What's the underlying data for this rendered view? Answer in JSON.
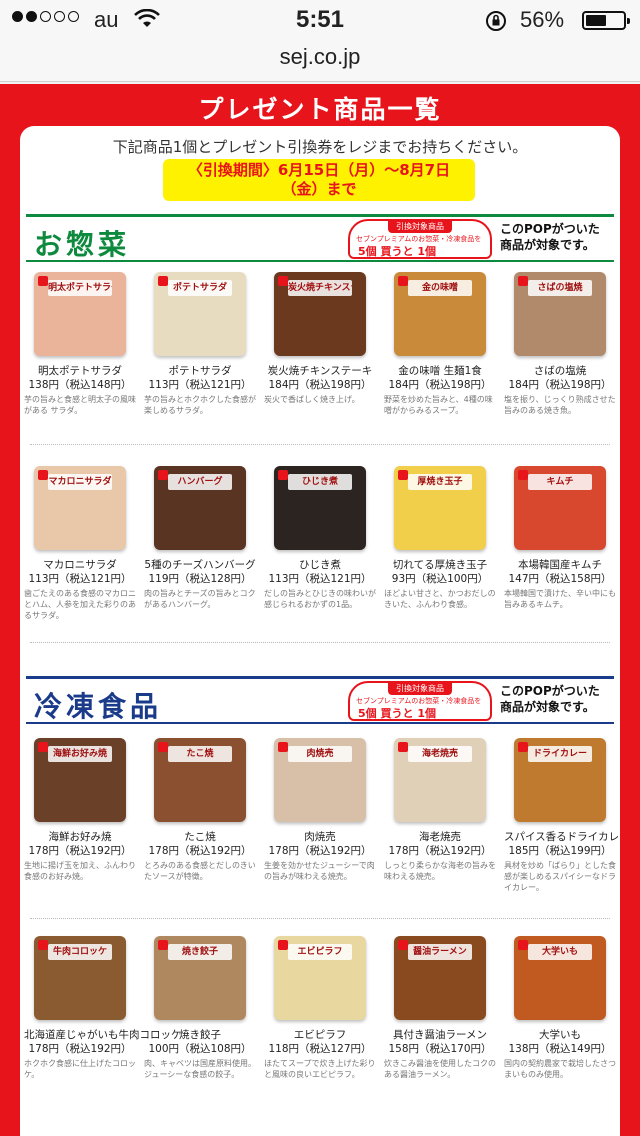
{
  "status_bar": {
    "carrier": "au",
    "time": "5:51",
    "battery_text": "56%",
    "battery_level": 0.56,
    "signal_bars": 2,
    "signal_total": 5
  },
  "url_bar": {
    "domain": "sej.co.jp"
  },
  "page": {
    "heading": "プレゼント商品一覧",
    "intro": "下記商品1個とプレゼント引換券をレジまでお持ちください。",
    "period_line1": "〈引換期間〉6月15日（月）〜8月7日",
    "period_line2": "（金）まで"
  },
  "sections": [
    {
      "title": "お惣菜",
      "color": "#0e8a3e",
      "pop_head": "引換対象商品",
      "pop_line": "セブンプレミアムのお惣菜・冷凍食品を",
      "pop_offer": "5個 買うと 1個",
      "pop_note_line1": "このPOPがついた",
      "pop_note_line2": "商品が対象です。",
      "items": [
        {
          "name": "明太ポテトサラダ",
          "price": "138円（税込148円）",
          "desc": "芋の旨みと食感と明太子の風味がある サラダ。",
          "pkg": "明太ポテトサラダ",
          "bg": "#e9b49a"
        },
        {
          "name": "ポテトサラダ",
          "price": "113円（税込121円）",
          "desc": "芋の旨みとホクホクした食感が楽しめるサラダ。",
          "pkg": "ポテトサラダ",
          "bg": "#e8dcc0"
        },
        {
          "name": "炭火焼チキンステーキ",
          "price": "184円（税込198円）",
          "desc": "炭火で香ばしく焼き上げ。",
          "pkg": "炭火焼チキンステーキ",
          "bg": "#6b3a1e"
        },
        {
          "name": "金の味噌 生麺1食",
          "price": "184円（税込198円）",
          "desc": "野菜を炒めた旨みと、4種の味噌がからみるスープ。",
          "pkg": "金の味噌",
          "bg": "#c98a3a"
        },
        {
          "name": "さばの塩焼",
          "price": "184円（税込198円）",
          "desc": "塩を振り、じっくり熟成させた旨みのある焼き魚。",
          "pkg": "さばの塩焼",
          "bg": "#b08a6a"
        }
      ]
    },
    {
      "items": [
        {
          "name": "マカロニサラダ",
          "price": "113円（税込121円）",
          "desc": "歯ごたえのある食感のマカロニとハム、人参を加えた彩りのあるサラダ。",
          "pkg": "マカロニサラダ",
          "bg": "#e8c8a8"
        },
        {
          "name": "5種のチーズハンバーグ",
          "price": "119円（税込128円）",
          "desc": "肉の旨みとチーズの旨みとコクがあるハンバーグ。",
          "pkg": "ハンバーグ",
          "bg": "#5a3422"
        },
        {
          "name": "ひじき煮",
          "price": "113円（税込121円）",
          "desc": "だしの旨みとひじきの味わいが感じられるおかずの1品。",
          "pkg": "ひじき煮",
          "bg": "#2b2420"
        },
        {
          "name": "切れてる厚焼き玉子",
          "price": "93円（税込100円）",
          "desc": "ほどよい甘さと、かつおだしのきいた、ふんわり食感。",
          "pkg": "厚焼き玉子",
          "bg": "#f1cf4a"
        },
        {
          "name": "本場韓国産キムチ",
          "price": "147円（税込158円）",
          "desc": "本場韓国で漬けた、辛い中にも旨みあるキムチ。",
          "pkg": "キムチ",
          "bg": "#d8482e"
        }
      ]
    },
    {
      "title": "冷凍食品",
      "color": "#1a3a8a",
      "pop_head": "引換対象商品",
      "pop_line": "セブンプレミアムのお惣菜・冷凍食品を",
      "pop_offer": "5個 買うと 1個",
      "pop_note_line1": "このPOPがついた",
      "pop_note_line2": "商品が対象です。",
      "items": [
        {
          "name": "海鮮お好み焼",
          "price": "178円（税込192円）",
          "desc": "生地に揚げ玉を加え、ふんわり食感のお好み焼。",
          "pkg": "海鮮お好み焼",
          "bg": "#6a4028"
        },
        {
          "name": "たこ焼",
          "price": "178円（税込192円）",
          "desc": "とろみのある食感とだしのきいたソースが特徴。",
          "pkg": "たこ焼",
          "bg": "#8a5030"
        },
        {
          "name": "肉焼売",
          "price": "178円（税込192円）",
          "desc": "生姜を効かせたジューシーで肉の旨みが味わえる焼売。",
          "pkg": "肉焼売",
          "bg": "#d8c0a8"
        },
        {
          "name": "海老焼売",
          "price": "178円（税込192円）",
          "desc": "しっとり柔らかな海老の旨みを味わえる焼売。",
          "pkg": "海老焼売",
          "bg": "#e0d0b8"
        },
        {
          "name": "スパイス香るドライカレー",
          "price": "185円（税込199円）",
          "desc": "具材を炒め「ばらり」とした食感が楽しめるスパイシーなドライカレー。",
          "pkg": "ドライカレー",
          "bg": "#c07a30"
        }
      ]
    },
    {
      "items": [
        {
          "name": "北海道産じゃがいも牛肉コロッケ",
          "price": "178円（税込192円）",
          "desc": "ホクホク食感に仕上げたコロッケ。",
          "pkg": "牛肉コロッケ",
          "bg": "#8a5a30"
        },
        {
          "name": "焼き餃子",
          "price": "100円（税込108円）",
          "desc": "肉、キャベツは国産原料使用。ジューシーな食感の餃子。",
          "pkg": "焼き餃子",
          "bg": "#b08860"
        },
        {
          "name": "エビピラフ",
          "price": "118円（税込127円）",
          "desc": "ほたてスープで炊き上げた彩りと風味の良いエビピラフ。",
          "pkg": "エビピラフ",
          "bg": "#e8d8a0"
        },
        {
          "name": "具付き醤油ラーメン",
          "price": "158円（税込170円）",
          "desc": "炊きこみ醤油を使用したコクのある醤油ラーメン。",
          "pkg": "醤油ラーメン",
          "bg": "#8a4a20"
        },
        {
          "name": "大学いも",
          "price": "138円（税込149円）",
          "desc": "国内の契約農家で栽培したさつまいものみ使用。",
          "pkg": "大学いも",
          "bg": "#c05a20"
        }
      ]
    }
  ]
}
